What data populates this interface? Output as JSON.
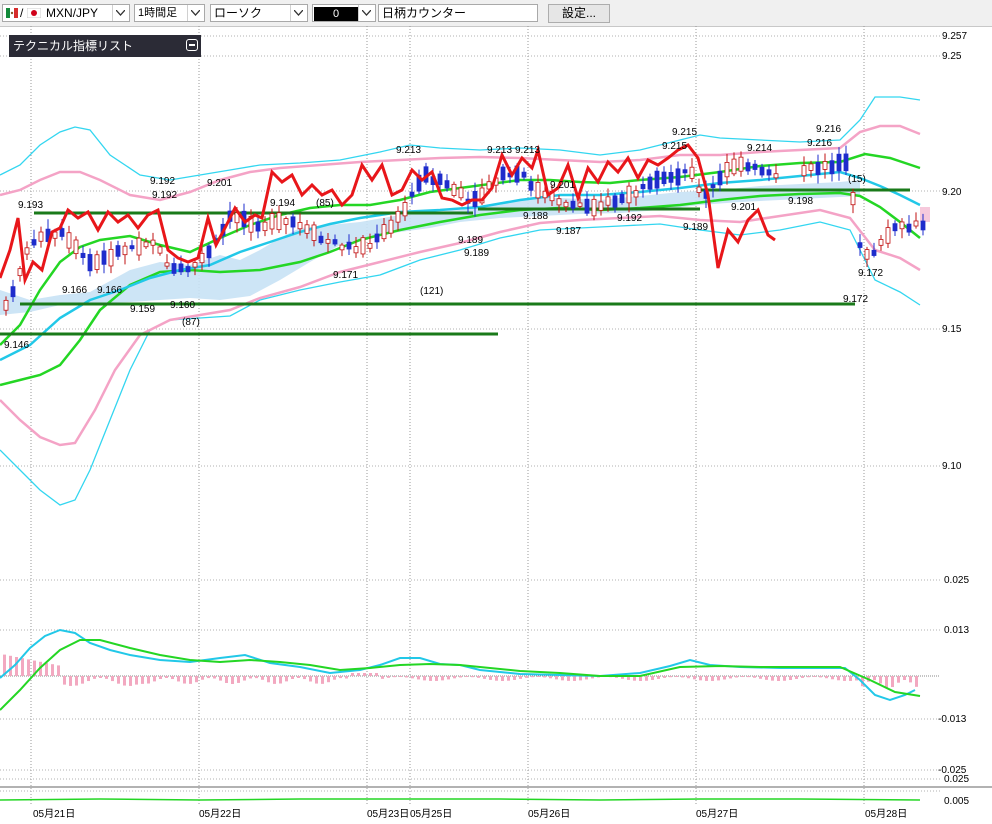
{
  "toolbar": {
    "symbol": "MXN/JPY",
    "timeframe": "1時間足",
    "chart_type": "ローソク",
    "color_value": "0",
    "symbol_counter": "日柄カウンター",
    "settings_label": "設定..."
  },
  "panel": {
    "title": "テクニカル指標リスト"
  },
  "colors": {
    "price_line": "#e8161a",
    "bb_outer": "#33d6f0",
    "bb_inner": "#f4a3c6",
    "ma_green": "#24d624",
    "ma_cyan": "#22c8e8",
    "hline": "#1a7a1a",
    "candle_up": "#ffffff",
    "candle_down": "#1e2ccc"
  },
  "price_axis": [
    "9.257",
    "9.25",
    "9.20",
    "9.15",
    "9.10"
  ],
  "osc_axis": [
    "0.025",
    "0.013",
    "-0.013",
    "-0.025"
  ],
  "osc2_axis": [
    "0.025",
    "0.005"
  ],
  "dates": [
    "05月21日",
    "05月22日",
    "05月23日",
    "05月25日",
    "05月26日",
    "05月27日",
    "05月28日"
  ],
  "annotations": [
    "9.193",
    "9.192",
    "9.192",
    "9.201",
    "9.166",
    "9.166",
    "9.159",
    "9.160",
    "(87)",
    "9.194",
    "(85)",
    "9.171",
    "9.213",
    "(121)",
    "9.189",
    "9.189",
    "9.213",
    "9.213",
    "9.201",
    "9.188",
    "9.187",
    "9.192",
    "9.215",
    "9.215",
    "9.189",
    "9.214",
    "9.201",
    "9.198",
    "9.216",
    "9.216",
    "(15)",
    "9.172",
    "9.172",
    "9.146"
  ]
}
